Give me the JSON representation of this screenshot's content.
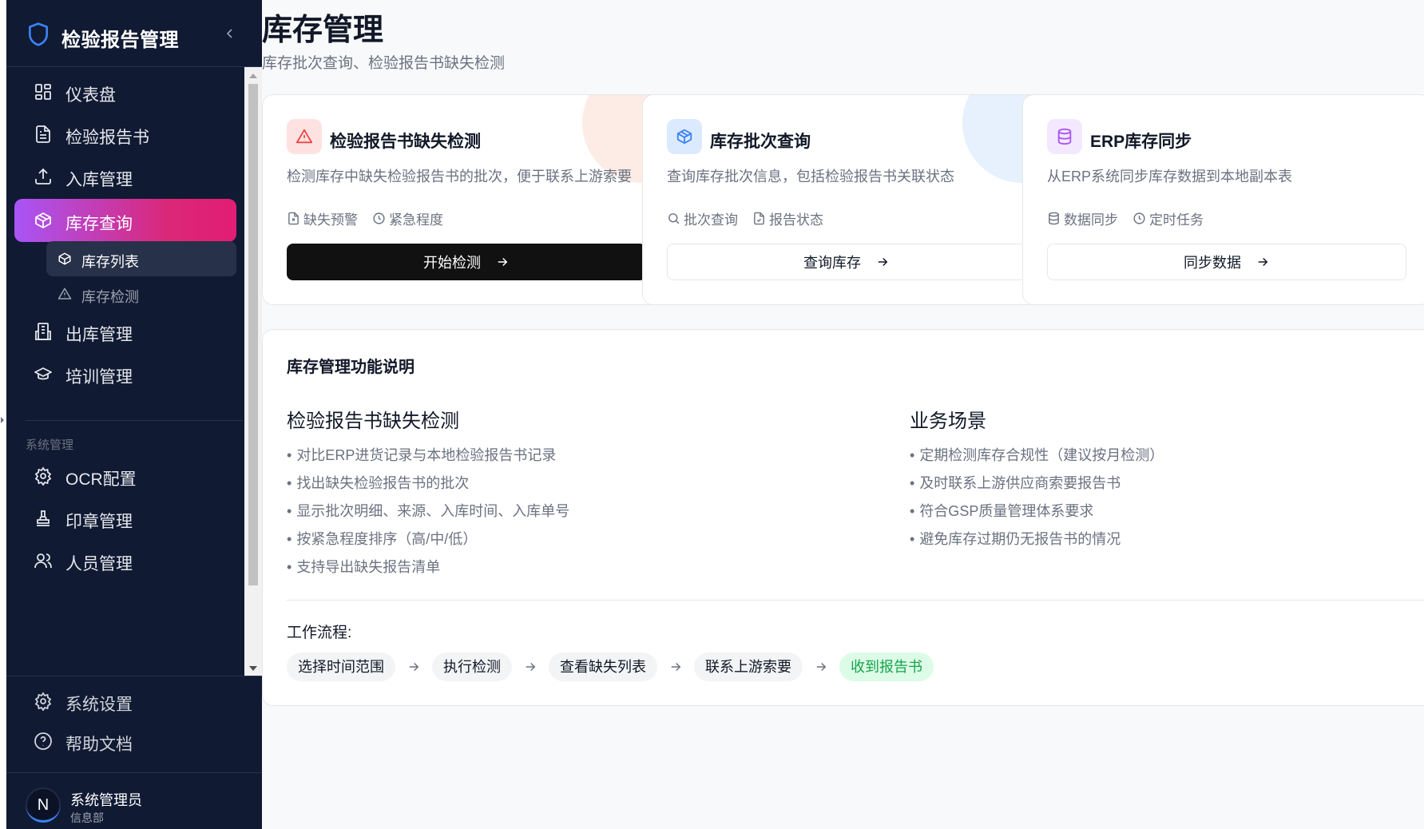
{
  "app": {
    "title": "检验报告管理"
  },
  "sidebar": {
    "items": [
      {
        "label": "仪表盘"
      },
      {
        "label": "检验报告书"
      },
      {
        "label": "入库管理"
      },
      {
        "label": "库存查询"
      },
      {
        "label": "出库管理"
      },
      {
        "label": "培训管理"
      }
    ],
    "sub_items": [
      {
        "label": "库存列表"
      },
      {
        "label": "库存检测"
      }
    ],
    "section_label": "系统管理",
    "system_items": [
      {
        "label": "OCR配置"
      },
      {
        "label": "印章管理"
      },
      {
        "label": "人员管理"
      }
    ],
    "bottom_items": [
      {
        "label": "系统设置"
      },
      {
        "label": "帮助文档"
      }
    ],
    "user": {
      "initial": "N",
      "name": "系统管理员",
      "dept": "信息部"
    }
  },
  "page": {
    "title": "库存管理",
    "subtitle": "库存批次查询、检验报告书缺失检测"
  },
  "cards": [
    {
      "title": "检验报告书缺失检测",
      "desc": "检测库存中缺失检验报告书的批次，便于联系上游索要",
      "tags": [
        "缺失预警",
        "紧急程度"
      ],
      "button": "开始检测",
      "accent": "#ef4444"
    },
    {
      "title": "库存批次查询",
      "desc": "查询库存批次信息，包括检验报告书关联状态",
      "tags": [
        "批次查询",
        "报告状态"
      ],
      "button": "查询库存",
      "accent": "#3b82f6"
    },
    {
      "title": "ERP库存同步",
      "desc": "从ERP系统同步库存数据到本地副本表",
      "tags": [
        "数据同步",
        "定时任务"
      ],
      "button": "同步数据",
      "accent": "#a855f7"
    }
  ],
  "info": {
    "title": "库存管理功能说明",
    "left": {
      "title": "检验报告书缺失检测",
      "bullets": [
        "对比ERP进货记录与本地检验报告书记录",
        "找出缺失检验报告书的批次",
        "显示批次明细、来源、入库时间、入库单号",
        "按紧急程度排序（高/中/低）",
        "支持导出缺失报告清单"
      ]
    },
    "right": {
      "title": "业务场景",
      "bullets": [
        "定期检测库存合规性（建议按月检测）",
        "及时联系上游供应商索要报告书",
        "符合GSP质量管理体系要求",
        "避免库存过期仍无报告书的情况"
      ]
    },
    "flow_label": "工作流程:",
    "steps": [
      "选择时间范围",
      "执行检测",
      "查看缺失列表",
      "联系上游索要",
      "收到报告书"
    ]
  }
}
